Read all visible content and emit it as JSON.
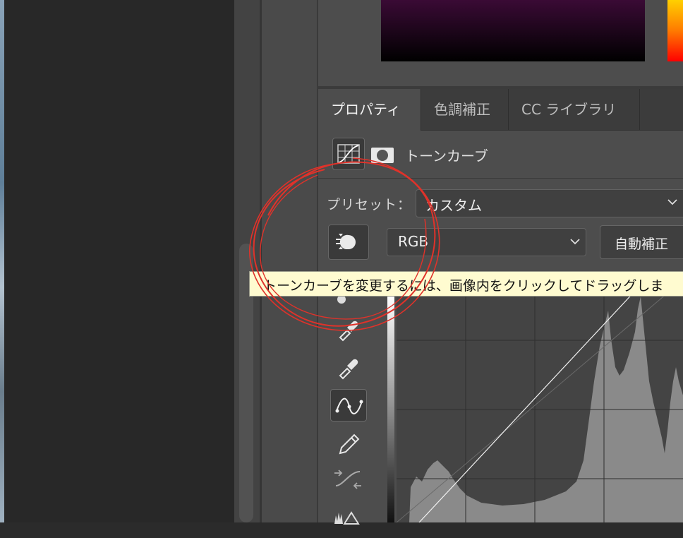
{
  "tabs": [
    {
      "label": "プロパティ",
      "active": true
    },
    {
      "label": "色調補正",
      "active": false
    },
    {
      "label": "CC ライブラリ",
      "active": false
    }
  ],
  "adjustment": {
    "title": "トーンカーブ",
    "icon": "curves-icon",
    "mask_icon": "layer-mask-icon"
  },
  "preset": {
    "label": "プリセット：",
    "value": "カスタム"
  },
  "channel": {
    "value": "RGB"
  },
  "auto_button": {
    "label": "自動補正"
  },
  "tools": [
    "target-adjustment-icon",
    "eyedropper-black-icon",
    "eyedropper-gray-icon",
    "eyedropper-white-icon",
    "curve-point-icon",
    "pencil-icon",
    "smooth-curve-icon",
    "histogram-warning-icon"
  ],
  "tooltip": {
    "text": "トーンカーブを変更するには、画像内をクリックしてドラッグしま"
  },
  "colors": {
    "panel_bg": "#4d4d4d",
    "tab_bar_bg": "#3c3c3c",
    "tooltip_bg": "#fffbd0",
    "annotation": "#e0322a"
  }
}
